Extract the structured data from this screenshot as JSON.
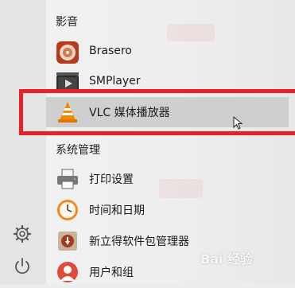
{
  "menu": {
    "categories": {
      "media": "影音",
      "system": "系统管理"
    },
    "items": [
      {
        "label": "Brasero",
        "icon": "brasero-disc-icon"
      },
      {
        "label": "SMPlayer",
        "icon": "smplayer-icon"
      },
      {
        "label": "VLC 媒体播放器",
        "icon": "vlc-cone-icon",
        "selected": true
      },
      {
        "label": "打印设置",
        "icon": "printer-icon"
      },
      {
        "label": "时间和日期",
        "icon": "clock-icon"
      },
      {
        "label": "新立得软件包管理器",
        "icon": "package-manager-icon"
      },
      {
        "label": "用户和组",
        "icon": "users-icon"
      }
    ]
  },
  "sidebar": {
    "settings_icon": "gear-icon",
    "power_icon": "power-icon"
  },
  "watermark": {
    "text": "Bai 经验"
  },
  "colors": {
    "highlight_border": "#e8202a",
    "selected_bg": "#cfcfcf"
  }
}
